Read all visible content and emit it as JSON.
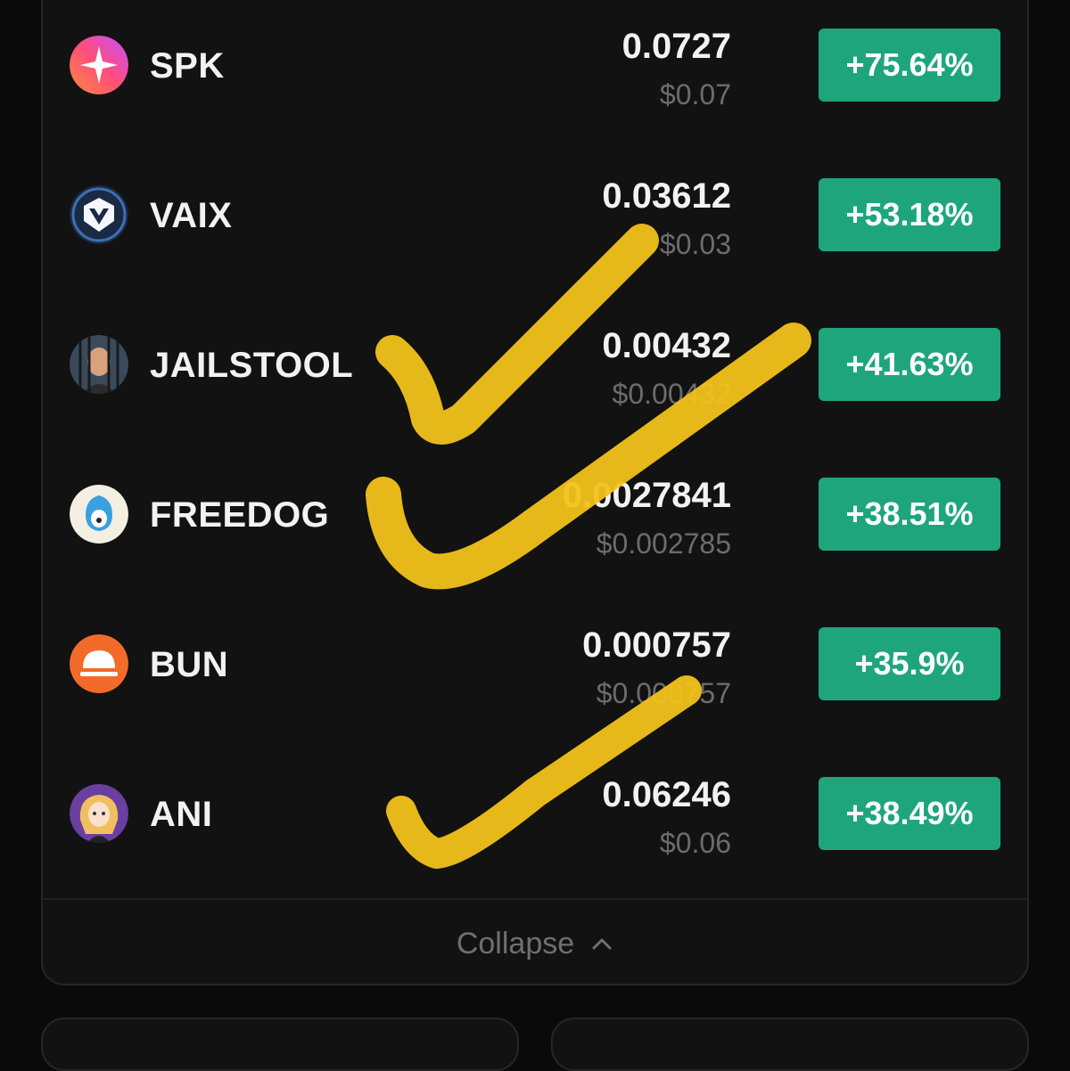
{
  "tokens": [
    {
      "symbol": "SPK",
      "price": "0.0727",
      "usd": "$0.07",
      "change": "+75.64%"
    },
    {
      "symbol": "VAIX",
      "price": "0.03612",
      "usd": "$0.03",
      "change": "+53.18%"
    },
    {
      "symbol": "JAILSTOOL",
      "price": "0.00432",
      "usd": "$0.00432",
      "change": "+41.63%"
    },
    {
      "symbol": "FREEDOG",
      "price": "0.0027841",
      "usd": "$0.002785",
      "change": "+38.51%"
    },
    {
      "symbol": "BUN",
      "price": "0.000757",
      "usd": "$0.000757",
      "change": "+35.9%"
    },
    {
      "symbol": "ANI",
      "price": "0.06246",
      "usd": "$0.06",
      "change": "+38.49%"
    }
  ],
  "collapse_label": "Collapse",
  "colors": {
    "background": "#0a0a0a",
    "card": "#121212",
    "gain": "#1fa57c",
    "annotation": "#f2c21b",
    "muted": "#6c6c6c"
  },
  "icons": [
    "spk-star-icon",
    "vaix-shield-icon",
    "jailstool-portrait-icon",
    "freedog-dog-icon",
    "bun-helmet-icon",
    "ani-anime-icon",
    "chevron-up-icon",
    "checkmark-annotation"
  ]
}
